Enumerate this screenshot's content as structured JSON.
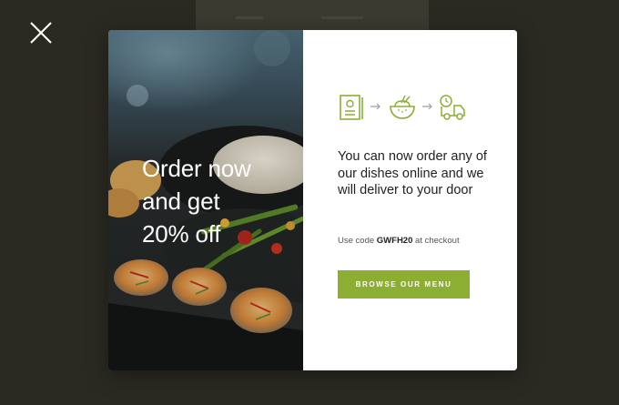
{
  "overlay": {
    "close_icon": "close-icon"
  },
  "promo": {
    "headline_lines": [
      "Order now",
      "and get",
      "20% off"
    ],
    "steps_icons": [
      "menu-card-icon",
      "arrow-right-icon",
      "food-bowl-icon",
      "arrow-right-icon",
      "delivery-truck-icon"
    ],
    "description": "You can now order any of our dishes online and we will deliver to your door",
    "code_prefix": "Use code",
    "code_value": "GWFH20",
    "code_suffix": "at checkout",
    "button_label": "BROWSE OUR MENU"
  },
  "colors": {
    "accent": "#8cae33",
    "backdrop": "#2a2a22"
  }
}
